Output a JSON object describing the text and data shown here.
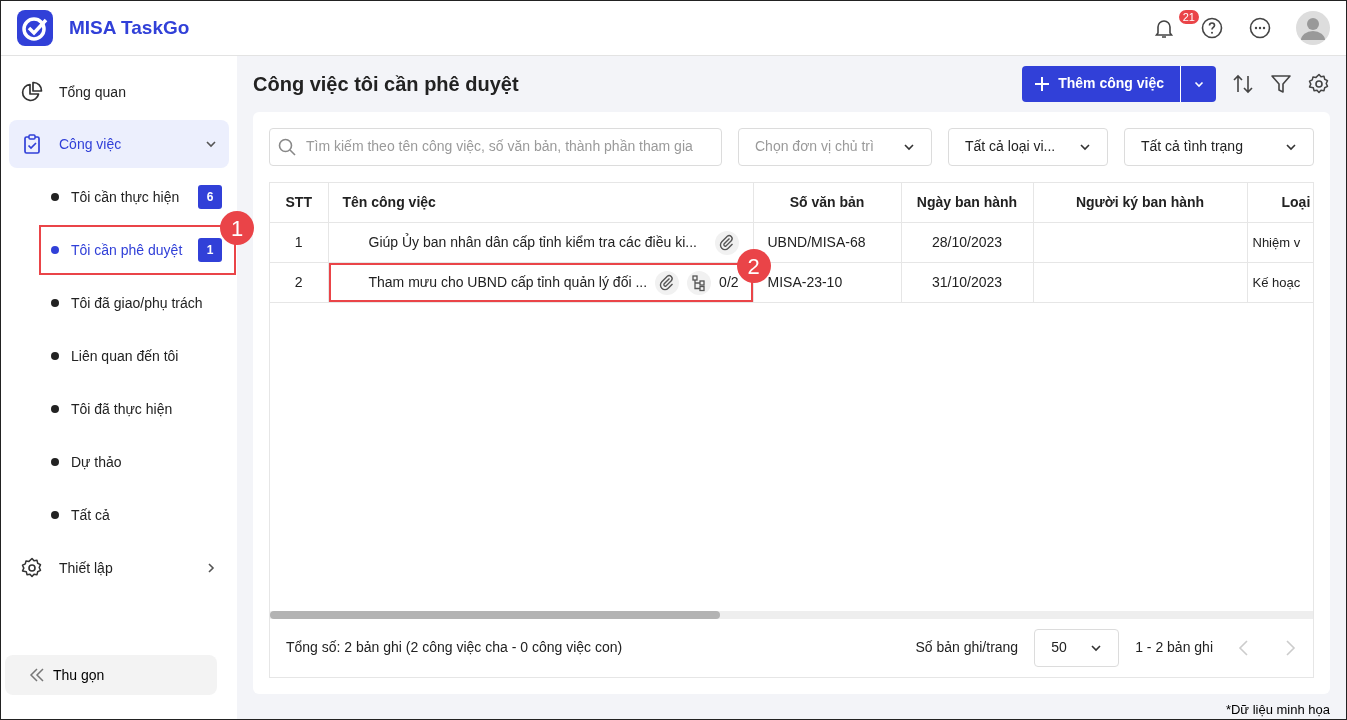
{
  "app": {
    "name": "MISA TaskGo"
  },
  "header": {
    "notification_count": "21"
  },
  "sidebar": {
    "items": [
      {
        "label": "Tổng quan",
        "kind": "overview",
        "selected": false
      },
      {
        "label": "Công việc",
        "kind": "tasks",
        "selected": true,
        "expanded": true,
        "children": [
          {
            "label": "Tôi cần thực hiện",
            "selected": false,
            "count": "6"
          },
          {
            "label": "Tôi cần phê duyệt",
            "selected": true,
            "count": "1",
            "callout": "1"
          },
          {
            "label": "Tôi đã giao/phụ trách",
            "selected": false
          },
          {
            "label": "Liên quan đến tôi",
            "selected": false
          },
          {
            "label": "Tôi đã thực hiện",
            "selected": false
          },
          {
            "label": "Dự thảo",
            "selected": false
          },
          {
            "label": "Tất cả",
            "selected": false
          }
        ]
      },
      {
        "label": "Thiết lập",
        "kind": "settings",
        "selected": false,
        "expanded": false
      }
    ],
    "collapse_button": "Thu gọn"
  },
  "page": {
    "title": "Công việc tôi cần phê duyệt",
    "add_button": "Thêm công việc"
  },
  "filters": {
    "search_placeholder": "Tìm kiếm theo tên công việc, số văn bản, thành phần tham gia",
    "unit_placeholder": "Chọn đơn vị chủ trì",
    "type_value": "Tất cả loại vi...",
    "status_value": "Tất cả tình trạng"
  },
  "table": {
    "columns": [
      "STT",
      "Tên công việc",
      "Số văn bản",
      "Ngày ban hành",
      "Người ký ban hành",
      "Loại"
    ],
    "rows": [
      {
        "stt": "1",
        "name": "Giúp Ủy ban nhân dân cấp tỉnh kiểm tra các điều ki...",
        "attachment": true,
        "doc_number": "UBND/MISA-68",
        "issue_date": "28/10/2023",
        "type": "Nhiệm v"
      },
      {
        "stt": "2",
        "name": "Tham mưu cho UBND cấp tỉnh quản lý đối ...",
        "attachment": true,
        "subtasks": "0/2",
        "doc_number": "MISA-23-10",
        "issue_date": "31/10/2023",
        "type": "Kế hoạc",
        "callout": "2"
      }
    ]
  },
  "footer": {
    "summary": "Tổng số: 2 bản ghi (2 công việc cha - 0 công việc con)",
    "page_size_label": "Số bản ghi/trang",
    "page_size": "50",
    "range": "1 - 2 bản ghi"
  },
  "note": "*Dữ liệu minh họa"
}
